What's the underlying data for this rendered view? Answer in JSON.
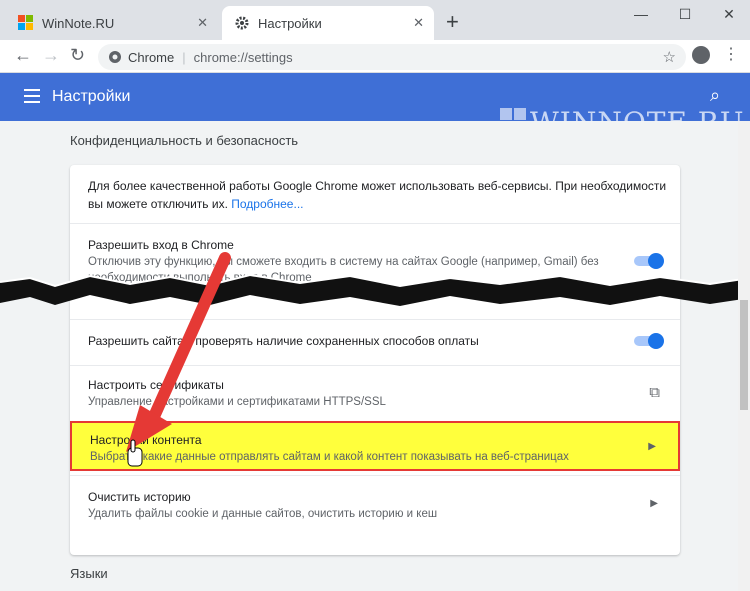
{
  "tabs": [
    {
      "label": "WinNote.RU",
      "close": "✕"
    },
    {
      "label": "Настройки",
      "close": "✕"
    }
  ],
  "new_tab": "+",
  "window_controls": {
    "minimize": "—",
    "maximize": "☐",
    "close": "✕"
  },
  "omnibox": {
    "chip": "Chrome",
    "url": "chrome://settings"
  },
  "appbar": {
    "title": "Настройки"
  },
  "watermark": "WINNOTE.RU",
  "section": {
    "title": "Конфиденциальность и безопасность"
  },
  "rows": {
    "services": {
      "text1": "Для более качественной работы Google Chrome может использовать веб-сервисы. При необходимости",
      "text2": "вы можете отключить их.",
      "link": "Подробнее..."
    },
    "signin": {
      "title": "Разрешить вход в Chrome",
      "sub1": "Отключив эту функцию, вы сможете входить в систему на сайтах Google (например, Gmail) без",
      "sub2": "необходимости выполнять вход в Chrome"
    },
    "payment": {
      "title": "Разрешить сайтам проверять наличие сохраненных способов оплаты"
    },
    "certs": {
      "title": "Настроить сертификаты",
      "sub": "Управление настройками и сертификатами HTTPS/SSL"
    },
    "content": {
      "title": "Настройки контента",
      "sub": "Выбрать, какие данные отправлять сайтам и какой контент показывать на веб-страницах"
    },
    "history": {
      "title": "Очистить историю",
      "sub": "Удалить файлы cookie и данные сайтов, очистить историю и кеш"
    }
  },
  "languages": {
    "title": "Языки"
  }
}
